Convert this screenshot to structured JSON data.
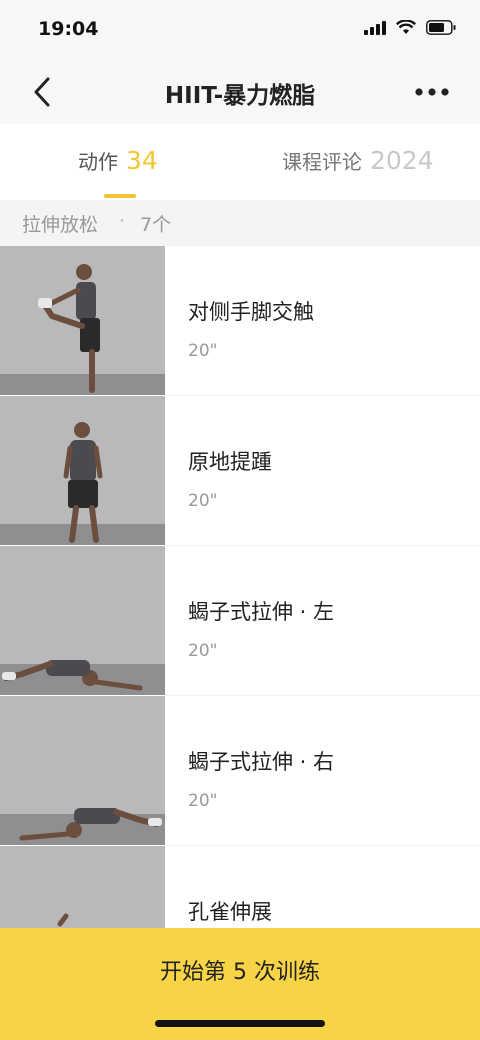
{
  "status_bar": {
    "time": "19:04"
  },
  "nav": {
    "title": "HIIT-暴力燃脂"
  },
  "tabs": [
    {
      "label": "动作",
      "count": "34",
      "active": true
    },
    {
      "label": "课程评论",
      "count": "2024",
      "active": false
    }
  ],
  "section": {
    "title": "拉伸放松",
    "dot": "·",
    "count": "7个"
  },
  "exercises": [
    {
      "name": "对侧手脚交触",
      "duration": "20\""
    },
    {
      "name": "原地提踵",
      "duration": "20\""
    },
    {
      "name": "蝎子式拉伸 · 左",
      "duration": "20\""
    },
    {
      "name": "蝎子式拉伸 · 右",
      "duration": "20\""
    },
    {
      "name": "孔雀伸展",
      "duration": ""
    }
  ],
  "start_button": {
    "label": "开始第 5 次训练"
  },
  "colors": {
    "accent": "#f2c533",
    "start_bar": "#f7d346"
  }
}
